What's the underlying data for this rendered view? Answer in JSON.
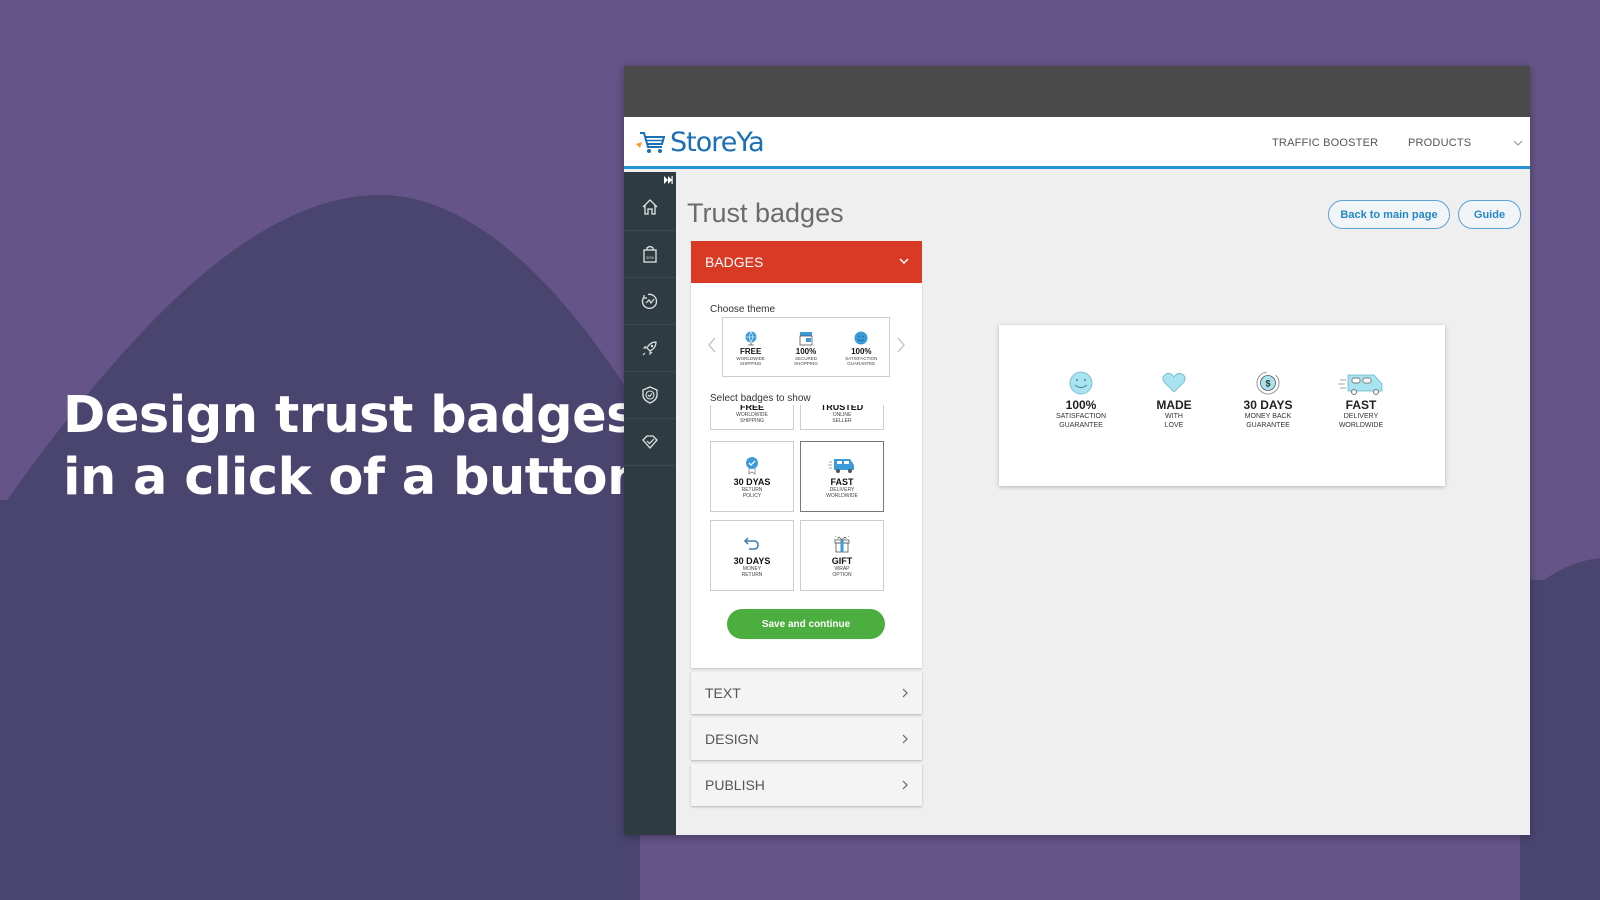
{
  "promo": {
    "headline_line1": "Design trust badges",
    "headline_line2": "in a click of a button"
  },
  "colors": {
    "background": "#655487",
    "background_hill": "#4a456f",
    "accent_blue": "#1f93d3",
    "accordion_active": "#d93a26",
    "save_green": "#4cae3e",
    "sidebar": "#2e3b41",
    "badge_icon_blue": "#3b9ad9",
    "preview_icon_light": "#a9e3ef"
  },
  "app": {
    "brand": "StoreYa",
    "nav": [
      {
        "label": "TRAFFIC BOOSTER"
      },
      {
        "label": "PRODUCTS"
      }
    ],
    "sidebar": {
      "items": [
        {
          "icon": "home-icon"
        },
        {
          "icon": "shopping-bag-icon"
        },
        {
          "icon": "growth-icon"
        },
        {
          "icon": "rocket-icon"
        },
        {
          "icon": "shield-check-icon"
        },
        {
          "icon": "diamond-check-icon"
        }
      ]
    },
    "page_title": "Trust badges",
    "buttons": {
      "back": "Back to main page",
      "guide": "Guide"
    },
    "accordion": {
      "badges": {
        "label": "BADGES",
        "choose_theme": "Choose theme",
        "theme_badges": [
          {
            "title": "FREE",
            "sub1": "WORLDWIDE",
            "sub2": "SHIPPING"
          },
          {
            "title": "100%",
            "sub1": "SECURED",
            "sub2": "SHOPPING"
          },
          {
            "title": "100%",
            "sub1": "SATISFACTION",
            "sub2": "GUARANTEE"
          }
        ],
        "select_badges": "Select badges to show",
        "badge_options": [
          {
            "title": "FREE",
            "sub1": "WORLDWIDE",
            "sub2": "SHIPPING",
            "selected": false
          },
          {
            "title": "TRUSTED",
            "sub1": "ONLINE",
            "sub2": "SELLER",
            "selected": false
          },
          {
            "title": "30 DYAS",
            "sub1": "RETURN",
            "sub2": "POLICY",
            "selected": false
          },
          {
            "title": "FAST",
            "sub1": "DELIVERY",
            "sub2": "WORLDWIDE",
            "selected": true
          },
          {
            "title": "30 DAYS",
            "sub1": "MONEY",
            "sub2": "RETURN",
            "selected": false
          },
          {
            "title": "GIFT",
            "sub1": "WRAP",
            "sub2": "OPTION",
            "selected": false
          }
        ],
        "save_label": "Save and continue"
      },
      "text": {
        "label": "TEXT"
      },
      "design": {
        "label": "DESIGN"
      },
      "publish": {
        "label": "PUBLISH"
      }
    },
    "preview": {
      "badges": [
        {
          "icon": "smiley-icon",
          "title": "100%",
          "sub1": "SATISFACTION",
          "sub2": "GUARANTEE"
        },
        {
          "icon": "heart-icon",
          "title": "MADE",
          "sub1": "WITH",
          "sub2": "LOVE"
        },
        {
          "icon": "money-back-icon",
          "title": "30 DAYS",
          "sub1": "MONEY BACK",
          "sub2": "GUARANTEE"
        },
        {
          "icon": "truck-icon",
          "title": "FAST",
          "sub1": "DELIVERY",
          "sub2": "WORLDWIDE"
        }
      ]
    }
  }
}
